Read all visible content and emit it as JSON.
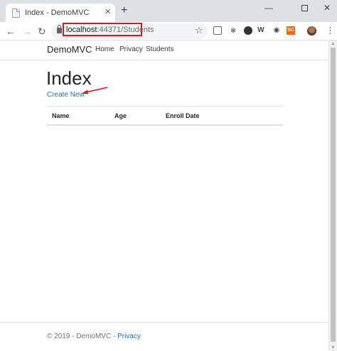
{
  "browser": {
    "tab_title": "Index - DemoMVC",
    "tab_close_glyph": "✕",
    "new_tab_glyph": "+",
    "url_host": "localhost",
    "url_path": ":44371/Students",
    "url_highlight_color": "#e0141e",
    "extension_badge_text": "SC",
    "window_controls": {
      "minimize": "—",
      "close": "✕"
    }
  },
  "site": {
    "brand": "DemoMVC",
    "nav": [
      "Home",
      "Privacy",
      "Students"
    ]
  },
  "main": {
    "title": "Index",
    "create_link": "Create New",
    "table": {
      "columns": [
        "Name",
        "Age",
        "Enroll Date"
      ],
      "rows": []
    }
  },
  "footer": {
    "text": "© 2019 - DemoMVC - ",
    "link": "Privacy"
  },
  "colors": {
    "link": "#1b6ec2",
    "annotation_arrow": "#e0141e"
  },
  "icons": {
    "back": "back-arrow-icon",
    "forward": "forward-arrow-icon",
    "reload": "reload-icon",
    "lock": "lock-icon",
    "bookmark": "star-icon",
    "menu": "three-dots-menu-icon"
  }
}
